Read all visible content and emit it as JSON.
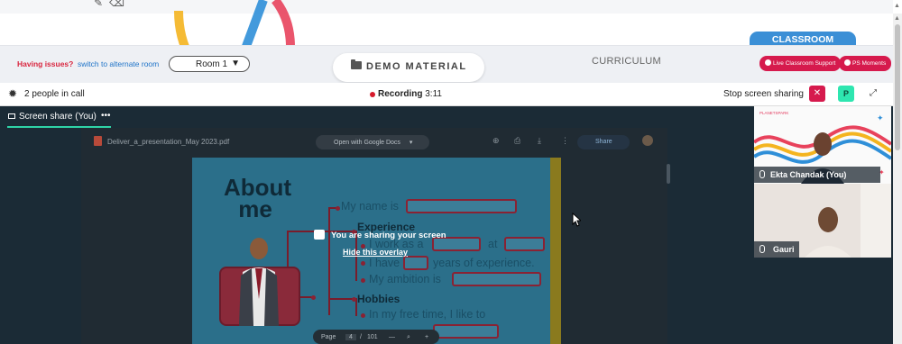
{
  "toolbar": {
    "pencil_icon": "pencil-icon",
    "eraser_icon": "eraser-icon"
  },
  "header": {
    "issues_label": "Having issues?",
    "alternate_room_link": "switch to alternate room",
    "room_select": {
      "value": "Room 1"
    },
    "demo_material_label": "DEMO MATERIAL",
    "curriculum_label": "CURRICULUM",
    "classroom_tab": "CLASSROOM",
    "live_support_button": "Live Classroom Support",
    "ps_moments_button": "PS Moments"
  },
  "call_bar": {
    "people_count": "2 people in call",
    "recording_label": "Recording",
    "recording_time": "3:11",
    "stop_sharing_label": "Stop screen sharing",
    "participant_badge": "P"
  },
  "stage": {
    "screen_share_tab": "Screen share (You)",
    "pdf": {
      "file_name": "Deliver_a_presentation_May 2023.pdf",
      "open_with": "Open with Google Docs",
      "share_label": "Share",
      "page_label": "Page",
      "page_current": "4",
      "page_total": "101"
    },
    "slide": {
      "title_line1": "About",
      "title_line2": "me",
      "name_line": "My name is",
      "experience_heading": "Experience",
      "work_line_a": "I work as a",
      "work_line_b": "at",
      "years_line_a": "I have",
      "years_line_b": "years of experience.",
      "ambition_line": "My ambition is",
      "hobbies_heading": "Hobbies",
      "free_time_line": "In my free time, I like to"
    },
    "overlay": {
      "title": "You are sharing your screen",
      "hide_link": "Hide this overlay"
    }
  },
  "participants": [
    {
      "name": "Ekta Chandak (You)",
      "brand": "PLANETSPARK"
    },
    {
      "name": "Gauri"
    }
  ],
  "colors": {
    "accent": "#d61a4d",
    "classroom_blue": "#3b8fd6",
    "teal": "#2fd4a8",
    "stage_bg": "#1b2b36"
  }
}
